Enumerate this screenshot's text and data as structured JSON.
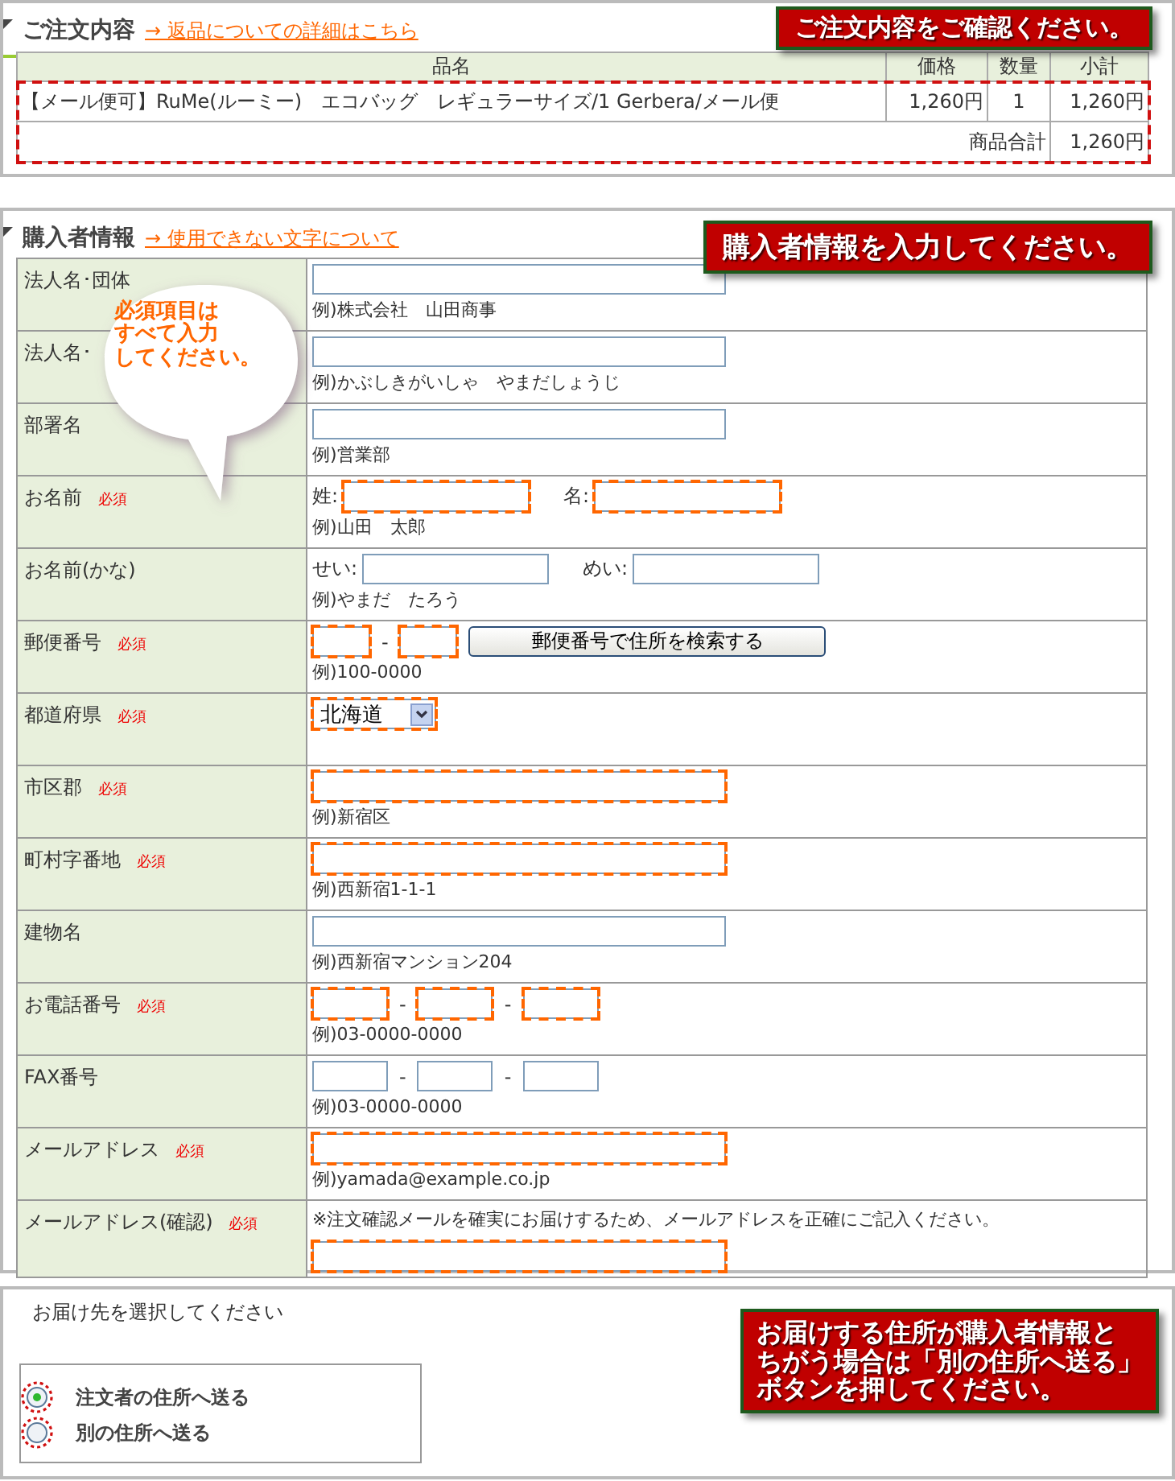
{
  "order": {
    "title": "ご注文内容",
    "link": "→ 返品についての詳細はこちら",
    "callout": "ご注文内容をご確認ください。",
    "columns": [
      "品名",
      "価格",
      "数量",
      "小計"
    ],
    "items": [
      {
        "name": "【メール便可】RuMe(ルーミー)　エコバッグ　レギュラーサイズ/1 Gerbera/メール便",
        "price": "1,260円",
        "qty": "1",
        "subtotal": "1,260円"
      }
    ],
    "total_label": "商品合計",
    "total": "1,260円"
  },
  "buyer": {
    "title": "購入者情報",
    "link": "→ 使用できない文字について",
    "callout": "購入者情報を入力してください。",
    "bubble": [
      "必須項目は",
      "すべて入力",
      "してください。"
    ],
    "rows": [
      {
        "kind": "text",
        "label": "法人名･団体",
        "required": false,
        "hint": "例)株式会社　山田商事"
      },
      {
        "kind": "text",
        "label": "法人名･",
        "required": false,
        "hint": "例)かぶしきがいしゃ　やまだしょうじ"
      },
      {
        "kind": "text",
        "label": "部署名",
        "required": false,
        "hint": "例)営業部"
      },
      {
        "kind": "pair",
        "label": "お名前",
        "badge": "必須",
        "required": true,
        "prefixes": [
          "姓:",
          "名:"
        ],
        "hint": "例)山田　太郎"
      },
      {
        "kind": "pair",
        "label": "お名前(かな)",
        "required": false,
        "prefixes": [
          "せい:",
          "めい:"
        ],
        "hint": "例)やまだ　たろう"
      },
      {
        "kind": "zip",
        "label": "郵便番号",
        "badge": "必須",
        "required": true,
        "separators": [
          "-"
        ],
        "button": "郵便番号で住所を検索する",
        "hint": "例)100-0000"
      },
      {
        "kind": "select",
        "label": "都道府県",
        "badge": "必須",
        "required": true,
        "value": "北海道"
      },
      {
        "kind": "text",
        "label": "市区郡",
        "badge": "必須",
        "required": true,
        "hint": "例)新宿区"
      },
      {
        "kind": "text",
        "label": "町村字番地",
        "badge": "必須",
        "required": true,
        "hint": "例)西新宿1-1-1"
      },
      {
        "kind": "text",
        "label": "建物名",
        "required": false,
        "hint": "例)西新宿マンション204"
      },
      {
        "kind": "phone",
        "label": "お電話番号",
        "badge": "必須",
        "required": true,
        "separators": [
          "-",
          "-"
        ],
        "hint": "例)03-0000-0000"
      },
      {
        "kind": "phone",
        "label": "FAX番号",
        "required": false,
        "separators": [
          "-",
          "-"
        ],
        "hint": "例)03-0000-0000"
      },
      {
        "kind": "text",
        "label": "メールアドレス",
        "badge": "必須",
        "required": true,
        "hint": "例)yamada@example.co.jp"
      },
      {
        "kind": "note",
        "label": "メールアドレス(確認)",
        "badge": "必須",
        "required": true,
        "note": "※注文確認メールを確実にお届けするため、メールアドレスを正確にご記入ください。"
      }
    ]
  },
  "delivery": {
    "prompt": "お届け先を選択してください",
    "callout": [
      "お届けする住所が購入者情報と",
      "ちがう場合は「別の住所へ送る」",
      "ボタンを押してください。"
    ],
    "options": [
      {
        "label": "注文者の住所へ送る",
        "selected": true
      },
      {
        "label": "別の住所へ送る",
        "selected": false
      }
    ]
  }
}
